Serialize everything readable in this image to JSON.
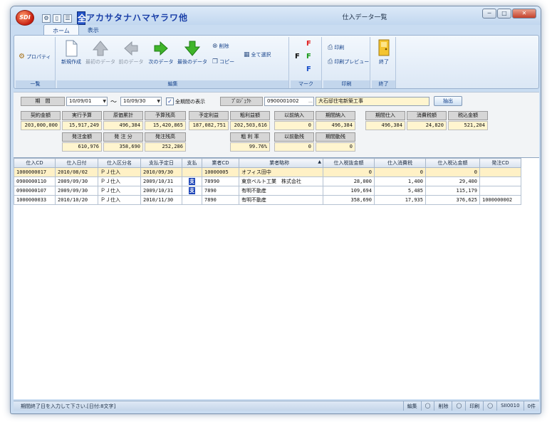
{
  "app": {
    "logo_text": "SDI",
    "title": "仕入データ一覧"
  },
  "quick_access": {
    "kana_filters": [
      "全",
      "ア",
      "カ",
      "サ",
      "タ",
      "ナ",
      "ハ",
      "マ",
      "ヤ",
      "ラ",
      "ワ",
      "他"
    ]
  },
  "window_controls": {
    "minimize": "─",
    "maximize": "□",
    "close": "✕"
  },
  "tabs": [
    {
      "label": "ホーム"
    },
    {
      "label": "表示"
    }
  ],
  "ribbon": {
    "groups": {
      "list": "一覧",
      "edit": "編集",
      "mark": "マーク",
      "print": "印刷",
      "exit": "終了"
    },
    "property": "プロパティ",
    "new": "新規作成",
    "first": "最初のデータ",
    "prev": "前のデータ",
    "next": "次のデータ",
    "last": "最後のデータ",
    "delete": "削除",
    "copy": "コピー",
    "select_all": "全て選択",
    "print": "印刷",
    "print_preview": "印刷プレビュー",
    "exit": "終了",
    "mark_letters": [
      "F",
      "F",
      "F",
      "F"
    ],
    "mark_colors": [
      "#111111",
      "#e02020",
      "#1a9a1a",
      "#1a4fc9"
    ]
  },
  "filter": {
    "period_label": "期　間",
    "date_from": "10/09/01",
    "tilde": "〜",
    "date_to": "10/09/30",
    "show_all_checkbox": "全期間の表示",
    "project_label": "ﾌﾟﾛｼﾞｪｸﾄ",
    "project_code": "0900001002",
    "project_name": "大石邸住宅新築工事",
    "extract_button": "抽出",
    "ellipsis": "…"
  },
  "summary": {
    "contract_amount": {
      "label": "契約金額",
      "value": "203,000,000"
    },
    "execution_budget": {
      "label": "実行予算",
      "value": "15,917,249"
    },
    "cost_total": {
      "label": "原価累計",
      "value": "496,384"
    },
    "budget_remaining": {
      "label": "予算残高",
      "value": "15,420,865"
    },
    "planned_profit": {
      "label": "予定利益",
      "value": "187,082,751"
    },
    "gross_profit": {
      "label": "粗利益額",
      "value": "202,503,616"
    },
    "gross_rate": {
      "label": "粗 利 率",
      "value": "99.76%"
    },
    "prev_purchase": {
      "label": "以前納入",
      "value": "0"
    },
    "period_purchase": {
      "label": "期間納入",
      "value": "496,384"
    },
    "prev_move": {
      "label": "以前動残",
      "value": "0"
    },
    "period_move": {
      "label": "期間動残",
      "value": "0"
    },
    "order_amount": {
      "label": "発注金額",
      "value": "610,976"
    },
    "order_part": {
      "label": "発 注 分",
      "value": "358,690"
    },
    "order_remaining": {
      "label": "発注残高",
      "value": "252,286"
    },
    "period_stock": {
      "label": "期間仕入",
      "value": "496,384"
    },
    "consumption_tax": {
      "label": "消費税額",
      "value": "24,820"
    },
    "tax_included": {
      "label": "税込金額",
      "value": "521,204"
    }
  },
  "grid": {
    "headers": [
      "仕入CD",
      "仕入日付",
      "仕入区分名",
      "支払予定日",
      "支払",
      "業者CD",
      "業者略称",
      "仕入税抜金額",
      "仕入消費税",
      "仕入税込金額",
      "発注CD"
    ],
    "sort_indicator": "▲",
    "rows": [
      {
        "cd": "1000000017",
        "date": "2010/08/02",
        "kind": "ＰＪ仕入",
        "pay_date": "2010/09/30",
        "pay": "",
        "vendor_cd": "10000005",
        "vendor": "オフィス田中",
        "net": "0",
        "tax": "0",
        "gross": "0",
        "order_cd": ""
      },
      {
        "cd": "0900000110",
        "date": "2009/09/30",
        "kind": "ＰＪ仕入",
        "pay_date": "2009/10/31",
        "pay": "支",
        "vendor_cd": "78990",
        "vendor": "東京ベルト工業　株式会社",
        "net": "28,000",
        "tax": "1,400",
        "gross": "29,400",
        "order_cd": ""
      },
      {
        "cd": "0900000107",
        "date": "2009/09/30",
        "kind": "ＰＪ仕入",
        "pay_date": "2009/10/31",
        "pay": "支",
        "vendor_cd": "7890",
        "vendor": "有明不動産",
        "net": "109,694",
        "tax": "5,485",
        "gross": "115,179",
        "order_cd": ""
      },
      {
        "cd": "1000000033",
        "date": "2010/10/20",
        "kind": "ＰＪ仕入",
        "pay_date": "2010/11/30",
        "pay": "",
        "vendor_cd": "7890",
        "vendor": "有明不動産",
        "net": "358,690",
        "tax": "17,935",
        "gross": "376,625",
        "order_cd": "1000000002"
      }
    ]
  },
  "statusbar": {
    "message": "期間終了日を入力して下さい.[日付:8文字]",
    "panes": [
      "編集",
      "◯",
      "削除",
      "◯",
      "印刷",
      "◯",
      "SII0010",
      "0件"
    ]
  }
}
